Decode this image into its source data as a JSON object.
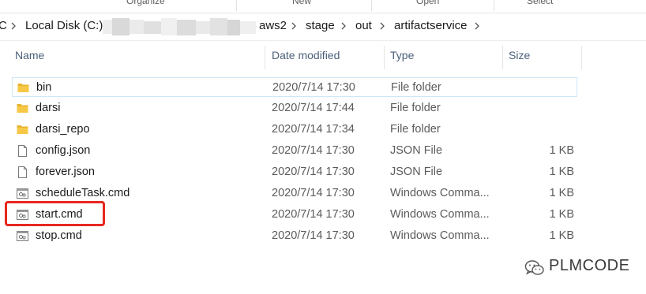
{
  "ribbon": {
    "groups": [
      "Organize",
      "New",
      "Open",
      "Select"
    ]
  },
  "address_bar": {
    "crumbs": [
      "C",
      "Local Disk (C:)",
      "aws2",
      "stage",
      "out",
      "artifactservice"
    ]
  },
  "columns": {
    "name": "Name",
    "date": "Date modified",
    "type": "Type",
    "size": "Size"
  },
  "files": [
    {
      "name": "bin",
      "date": "2020/7/14 17:30",
      "type": "File folder",
      "size": "",
      "icon": "folder-icon"
    },
    {
      "name": "darsi",
      "date": "2020/7/14 17:44",
      "type": "File folder",
      "size": "",
      "icon": "folder-icon"
    },
    {
      "name": "darsi_repo",
      "date": "2020/7/14 17:34",
      "type": "File folder",
      "size": "",
      "icon": "folder-icon"
    },
    {
      "name": "config.json",
      "date": "2020/7/14 17:30",
      "type": "JSON File",
      "size": "1 KB",
      "icon": "file-icon"
    },
    {
      "name": "forever.json",
      "date": "2020/7/14 17:30",
      "type": "JSON File",
      "size": "1 KB",
      "icon": "file-icon"
    },
    {
      "name": "scheduleTask.cmd",
      "date": "2020/7/14 17:30",
      "type": "Windows Comma...",
      "size": "1 KB",
      "icon": "cmd-file-icon"
    },
    {
      "name": "start.cmd",
      "date": "2020/7/14 17:30",
      "type": "Windows Comma...",
      "size": "1 KB",
      "icon": "cmd-file-icon"
    },
    {
      "name": "stop.cmd",
      "date": "2020/7/14 17:30",
      "type": "Windows Comma...",
      "size": "1 KB",
      "icon": "cmd-file-icon"
    }
  ],
  "watermark": {
    "text": "PLMCODE",
    "icon": "wechat-icon"
  },
  "colors": {
    "highlight": "#e8271f",
    "folder": "#f7c846",
    "header_text": "#4c607a",
    "selection_border": "#cde8f7"
  }
}
